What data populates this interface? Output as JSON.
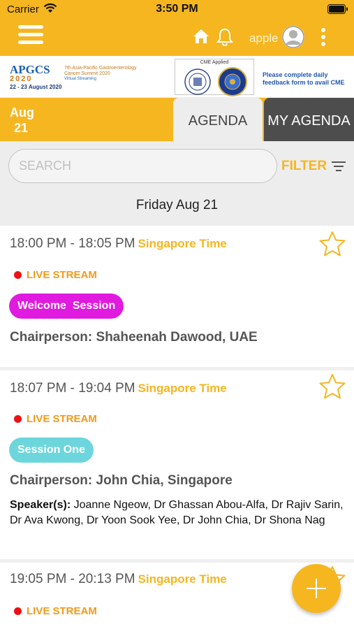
{
  "status": {
    "carrier": "Carrier",
    "time": "3:50 PM"
  },
  "header": {
    "user": "apple"
  },
  "banner": {
    "apgcs_mark": "APGCS",
    "apgcs_year": "2020",
    "apgcs_title": "7th Asia-Pacific Gastroenterology Cancer Summit 2020",
    "apgcs_sub": "Virtual Streaming",
    "apgcs_dates": "22 - 23 August 2020",
    "cme_label": "CME Applied",
    "cme_note": "Please complete daily feedback form to avail CME"
  },
  "datebar": {
    "month": "Aug",
    "day": "21"
  },
  "tabs": {
    "agenda": "AGENDA",
    "my_agenda": "MY AGENDA"
  },
  "search": {
    "placeholder": "SEARCH",
    "value": ""
  },
  "filter": {
    "label": "FILTER"
  },
  "day_header": "Friday Aug 21",
  "colors": {
    "accent": "#f5b620",
    "welcome": "#e01adf",
    "session_one": "#6cd6dc",
    "live": "#ee1111"
  },
  "sessions": [
    {
      "time": "18:00 PM - 18:05 PM",
      "tz": "Singapore Time",
      "live": "LIVE STREAM",
      "pill": "Welcome  Session",
      "chair": "Chairperson: Shaheenah Dawood, UAE"
    },
    {
      "time": "18:07 PM - 19:04 PM",
      "tz": "Singapore Time",
      "live": "LIVE STREAM",
      "pill": "Session One",
      "chair": "Chairperson: John Chia, Singapore",
      "speakers_label": "Speaker(s):",
      "speakers": " Joanne Ngeow, Dr Ghassan Abou-Alfa, Dr Rajiv Sarin, Dr Ava Kwong, Dr Yoon Sook Yee, Dr John Chia, Dr Shona Nag"
    },
    {
      "time": "19:05 PM - 20:13 PM",
      "tz": "Singapore Time",
      "live": "LIVE STREAM"
    }
  ]
}
